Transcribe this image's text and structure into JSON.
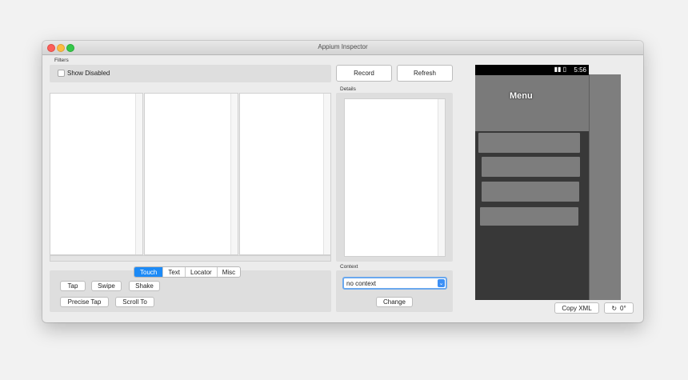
{
  "window": {
    "title": "Appium Inspector"
  },
  "filters": {
    "label": "Filters",
    "show_disabled_label": "Show Disabled"
  },
  "toolbar": {
    "record_label": "Record",
    "refresh_label": "Refresh"
  },
  "details": {
    "label": "Details"
  },
  "tabs": [
    {
      "label": "Touch",
      "active": true
    },
    {
      "label": "Text",
      "active": false
    },
    {
      "label": "Locator",
      "active": false
    },
    {
      "label": "Misc",
      "active": false
    }
  ],
  "touch_actions": {
    "tap": "Tap",
    "swipe": "Swipe",
    "shake": "Shake",
    "precise_tap": "Precise Tap",
    "scroll_to": "Scroll To"
  },
  "context": {
    "label": "Context",
    "selected": "no context",
    "change_label": "Change"
  },
  "device": {
    "status_time": "5:56",
    "status_icons": "signal-battery-icons",
    "menu_title": "Menu"
  },
  "bottom_bar": {
    "copy_xml_label": "Copy XML",
    "rotation_label": "0°"
  },
  "colors": {
    "accent": "#1c8af6",
    "select_border": "#6aa8ee"
  }
}
